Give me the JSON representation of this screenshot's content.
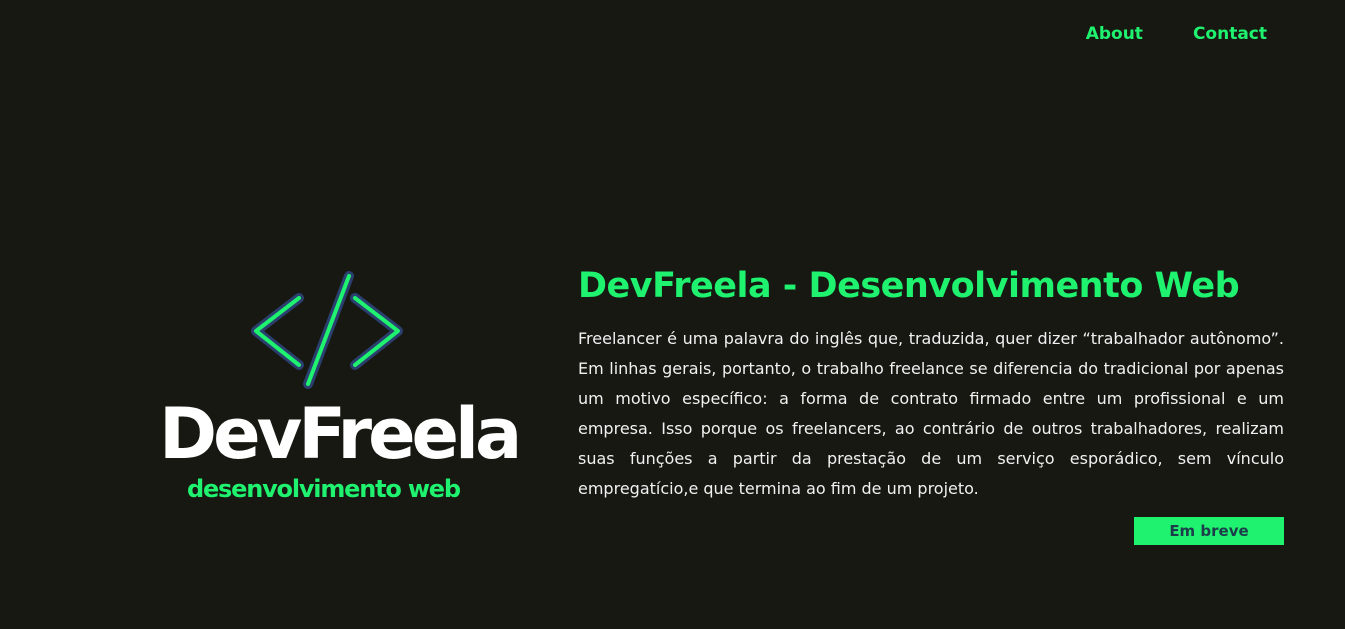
{
  "nav": {
    "about_label": "About",
    "contact_label": "Contact"
  },
  "logo": {
    "icon": "code-brackets-icon",
    "wordmark": "DevFreela",
    "tagline": "desenvolvimento web"
  },
  "main": {
    "title": "DevFreela - Desenvolvimento Web",
    "description": "Freelancer é uma palavra do inglês que, traduzida, quer dizer “trabalhador autônomo”. Em linhas gerais, portanto, o trabalho freelance se diferencia do tradicional por apenas um motivo específico: a forma de contrato firmado entre um profissional e um empresa. Isso porque os freelancers, ao contrário de outros trabalhadores, realizam suas funções a partir da prestação de um serviço esporádico, sem vínculo empregatício,e que termina ao fim de um projeto.",
    "button_label": "Em breve"
  },
  "colors": {
    "background": "#171812",
    "accent": "#1ef26e",
    "text": "#f1f1f1",
    "button_text": "#1d3d4a",
    "icon_outline": "#2b3f6e"
  }
}
